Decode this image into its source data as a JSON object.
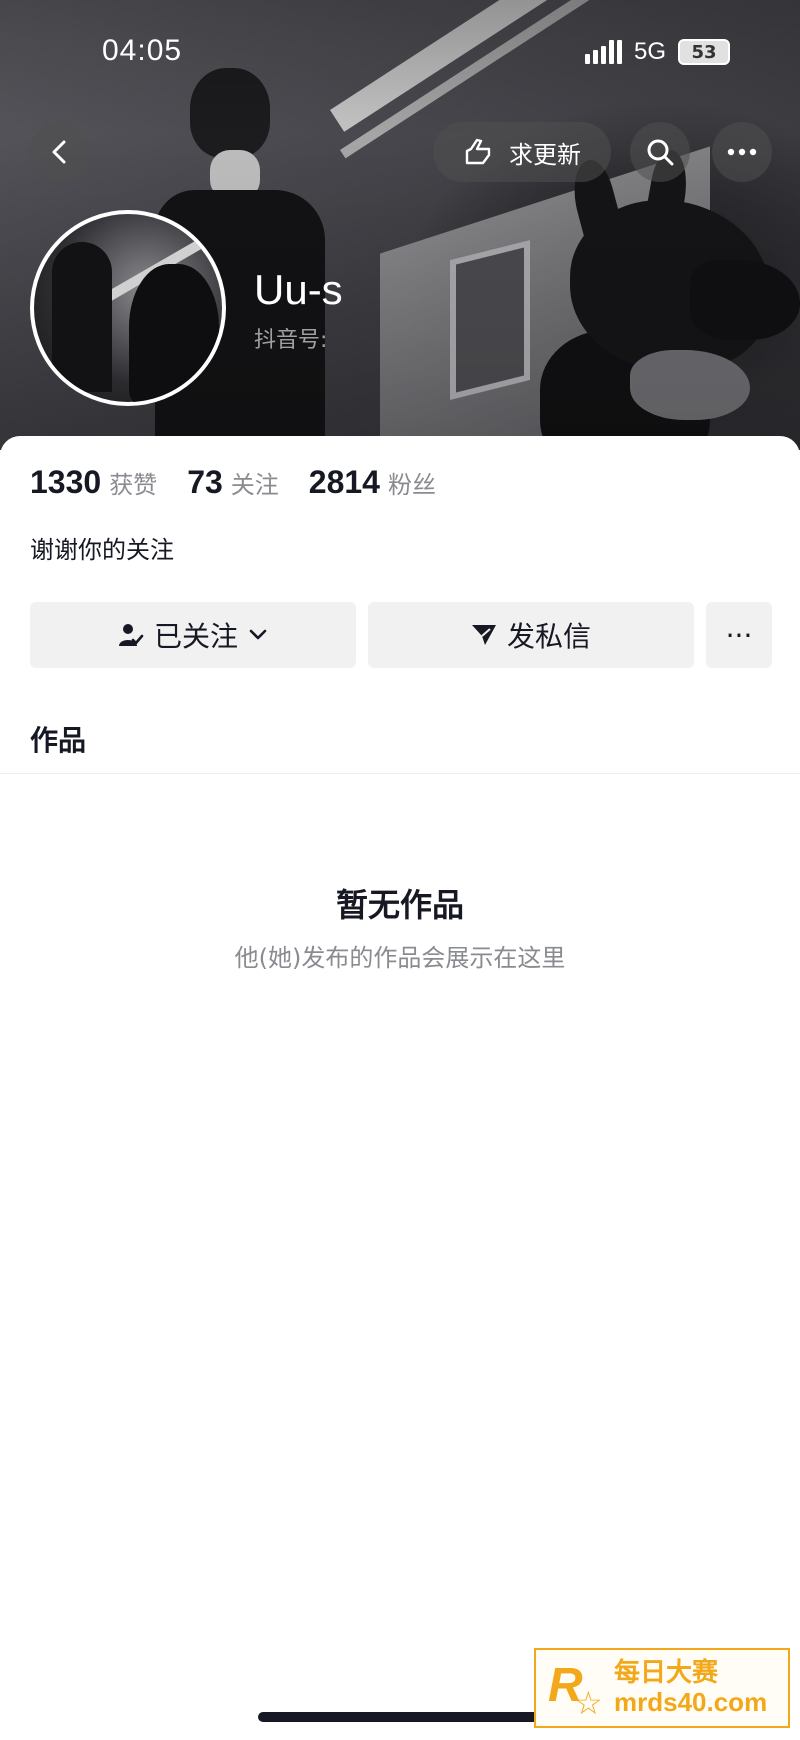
{
  "status_bar": {
    "time": "04:05",
    "network": "5G",
    "battery": "53"
  },
  "header": {
    "update_label": "求更新"
  },
  "profile": {
    "nickname": "Uu-s",
    "id_label": "抖音号",
    "bio": "谢谢你的关注"
  },
  "stats": [
    {
      "value": "1330",
      "label": "获赞"
    },
    {
      "value": "73",
      "label": "关注"
    },
    {
      "value": "2814",
      "label": "粉丝"
    }
  ],
  "actions": {
    "follow_label": "已关注",
    "message_label": "发私信",
    "more_label": "···"
  },
  "tabs": {
    "works": "作品"
  },
  "empty_state": {
    "title": "暂无作品",
    "subtitle": "他(她)发布的作品会展示在这里"
  },
  "watermark": {
    "logo_letter": "R",
    "title": "每日大赛",
    "url": "mrds40.com"
  },
  "colors": {
    "text_primary": "#161823",
    "text_secondary": "#8a8b91",
    "button_bg": "#f1f1f2",
    "watermark_accent": "#f2a81a"
  }
}
